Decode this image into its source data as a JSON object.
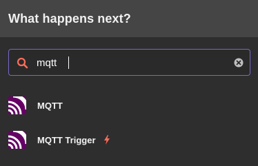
{
  "header": {
    "title": "What happens next?"
  },
  "search": {
    "value": "mqtt",
    "placeholder": ""
  },
  "results": [
    {
      "label": "MQTT",
      "icon": "mqtt-icon"
    },
    {
      "label": "MQTT Trigger",
      "icon": "mqtt-icon",
      "badge_icon": "lightning-bolt-icon"
    }
  ],
  "colors": {
    "accent": "#7a68c8",
    "search_icon": "#ff6d5a",
    "mqtt_icon": "#660066",
    "trigger_bolt": "#ff6d5a"
  }
}
